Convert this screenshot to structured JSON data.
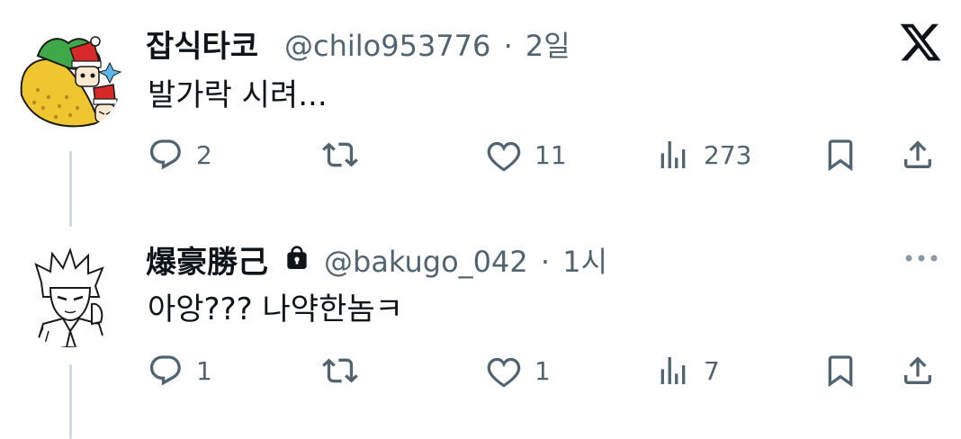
{
  "tweets": [
    {
      "author_name": "잡식타코",
      "author_handle": "@chilo953776",
      "separator": "·",
      "time_ago": "2일",
      "text": "발가락 시려...",
      "reply_count": "2",
      "like_count": "11",
      "view_count": "273",
      "corner_icon": "x-logo-icon"
    },
    {
      "author_name": "爆豪勝己",
      "locked": true,
      "author_handle": "@bakugo_042",
      "separator": "·",
      "time_ago": "1시",
      "text": "아앙??? 나약한놈ㅋ",
      "reply_count": "1",
      "like_count": "1",
      "view_count": "7",
      "corner_icon": "more-dots-icon"
    }
  ],
  "icons": [
    "reply-icon",
    "retweet-icon",
    "like-icon",
    "views-icon",
    "bookmark-icon",
    "share-icon",
    "lock-icon"
  ],
  "colors": {
    "text": "#0f1419",
    "secondary": "#536471",
    "thread_line": "#cfd9de"
  }
}
